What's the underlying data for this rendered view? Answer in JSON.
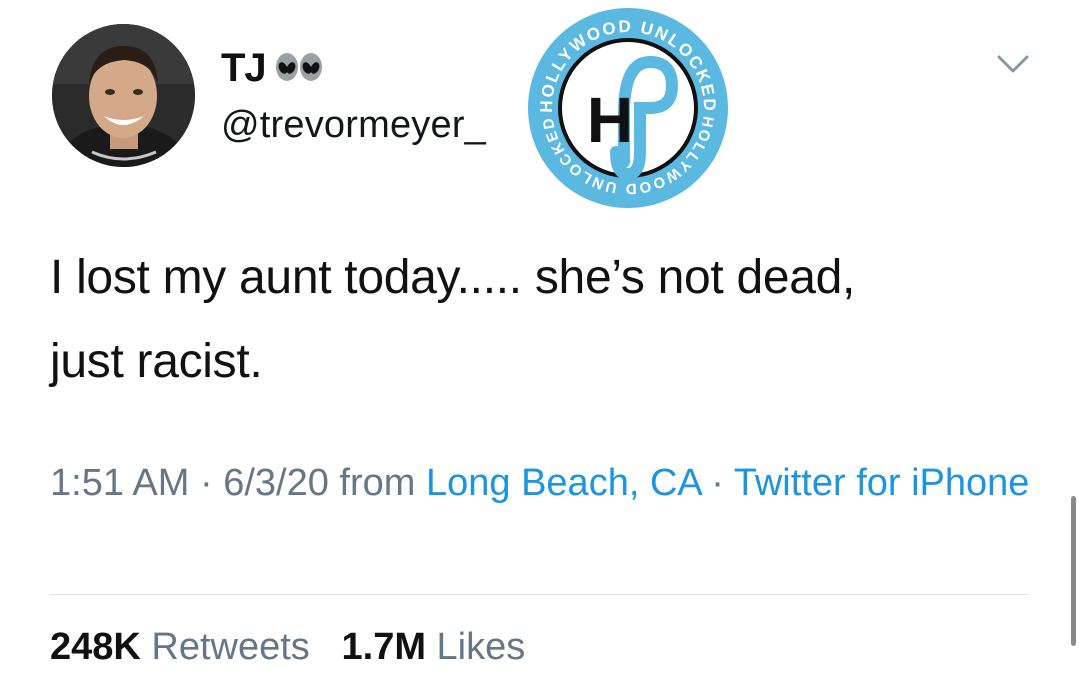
{
  "user": {
    "display_name": "TJ",
    "handle": "@trevormeyer_",
    "emoji": "alien-icon"
  },
  "watermark": {
    "text_top": "HOLLYWOOD UNLOCKED",
    "text_bottom": "HOLLYWOOD UNLOCKED",
    "monogram": "H",
    "colors": {
      "ring": "#5bb8e0",
      "inner": "#ffffff",
      "ink": "#111111"
    }
  },
  "tweet": {
    "text_line1": "I lost my aunt today..... she’s not dead,",
    "text_line2": "just racist."
  },
  "meta": {
    "time": "1:51 AM",
    "sep1": " · ",
    "date": "6/3/20",
    "from": " from ",
    "location": "Long Beach, CA",
    "sep2": " · ",
    "source": "Twitter for iPhone"
  },
  "stats": {
    "retweets_count": "248K",
    "retweets_label": "Retweets",
    "likes_count": "1.7M",
    "likes_label": "Likes"
  },
  "colors": {
    "link": "#1b95e0",
    "secondary": "#657786",
    "text": "#111111"
  }
}
